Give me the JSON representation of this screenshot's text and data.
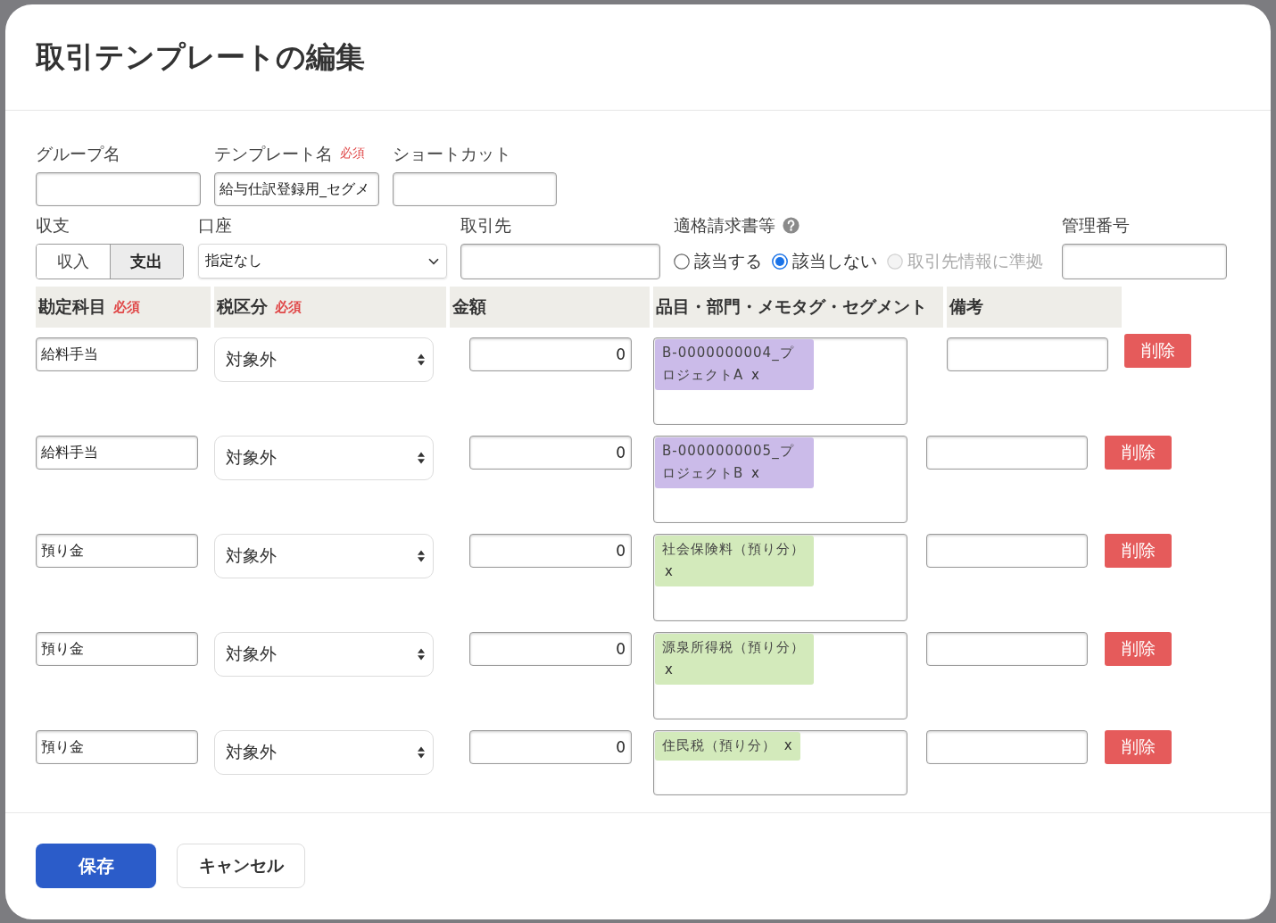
{
  "dialog": {
    "title": "取引テンプレートの編集"
  },
  "template_fields": [
    {
      "label": "グループ名"
    },
    {
      "label": "テンプレート名",
      "required": "必須",
      "value": "給与仕訳登録用_セグメ"
    },
    {
      "label": "ショートカット"
    }
  ],
  "income_expense": {
    "label": "収支",
    "options": [
      {
        "label": "収入",
        "selected": false
      },
      {
        "label": "支出",
        "selected": true
      }
    ]
  },
  "account": {
    "label": "口座",
    "value": "指定なし"
  },
  "partner": {
    "label": "取引先"
  },
  "qualified_invoice": {
    "label": "適格請求書等",
    "options": [
      {
        "label": "該当する",
        "selected": false,
        "disabled": false
      },
      {
        "label": "該当しない",
        "selected": true,
        "disabled": false
      },
      {
        "label": "取引先情報に準拠",
        "selected": false,
        "disabled": true
      }
    ]
  },
  "management_number": {
    "label": "管理番号"
  },
  "lines": {
    "columns": [
      {
        "label": "勘定科目",
        "required": "必須"
      },
      {
        "label": "税区分",
        "required": "必須"
      },
      {
        "label": "金額"
      },
      {
        "label": "品目・部門・メモタグ・セグメント"
      },
      {
        "label": "備考"
      }
    ],
    "rows": [
      {
        "account": "給料手当",
        "tax": "対象外",
        "amount": "0",
        "tags": [
          {
            "label": "B-0000000004_プロジェクトA",
            "remove": "x",
            "color": "#cbbbe9"
          }
        ],
        "delete": "削除"
      },
      {
        "account": "給料手当",
        "tax": "対象外",
        "amount": "0",
        "tags": [
          {
            "label": "B-0000000005_プロジェクトB",
            "remove": "x",
            "color": "#cbbbe9"
          }
        ],
        "delete": "削除"
      },
      {
        "account": "預り金",
        "tax": "対象外",
        "amount": "0",
        "tags": [
          {
            "label": "社会保険料（預り分）",
            "remove": "x",
            "color": "#d3eabb"
          }
        ],
        "delete": "削除"
      },
      {
        "account": "預り金",
        "tax": "対象外",
        "amount": "0",
        "tags": [
          {
            "label": "源泉所得税（預り分）",
            "remove": "x",
            "color": "#d3eabb"
          }
        ],
        "delete": "削除"
      },
      {
        "account": "預り金",
        "tax": "対象外",
        "amount": "0",
        "tags": [
          {
            "label": "住民税（預り分）",
            "remove": "x",
            "color": "#d3eabb"
          }
        ],
        "delete": "削除"
      }
    ]
  },
  "buttons": [
    {
      "label": "保存",
      "kind": "primary"
    },
    {
      "label": "キャンセル",
      "kind": "secondary"
    }
  ]
}
